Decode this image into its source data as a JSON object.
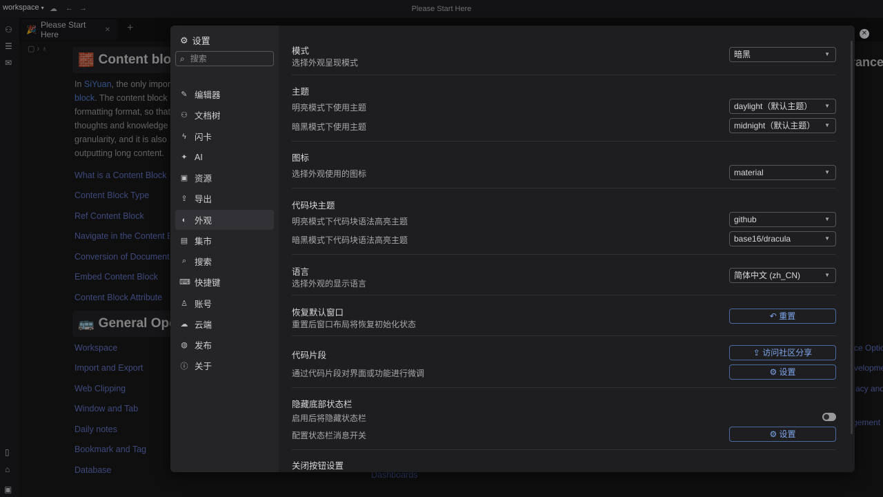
{
  "titlebar": {
    "workspace": "workspace",
    "window_title": "Please Start Here"
  },
  "tab": {
    "label": "Please Start Here"
  },
  "doc": {
    "heading1": "Content bloc",
    "para_prefix": "In ",
    "para_link1": "SiYuan",
    "para_mid": ", the only impor",
    "para_link2": "block",
    "para_rest": ". The content block formatting format, so that thoughts and knowledge granularity, and it is also outputting long content.",
    "links1": [
      "What is a Content Block",
      "Content Block Type",
      "Ref Content Block",
      "Navigate in the Content B",
      "Conversion of Document",
      "Embed Content Block",
      "Content Block Attribute"
    ],
    "heading2": "General Ope",
    "links2": [
      "Workspace",
      "Import and Export",
      "Web Clipping",
      "Window and Tab",
      "Daily notes",
      "Bookmark and Tag",
      "Database"
    ],
    "right_fragments": [
      "rance",
      "ce Optic",
      "velopme",
      "acy and",
      "gement"
    ],
    "bottom_fragment": "Dashboards"
  },
  "settings": {
    "title": "设置",
    "search_placeholder": "搜索",
    "nav": [
      {
        "label": "编辑器",
        "icon": "edit-icon"
      },
      {
        "label": "文档树",
        "icon": "tree-icon"
      },
      {
        "label": "闪卡",
        "icon": "flash-icon"
      },
      {
        "label": "AI",
        "icon": "sparkle-icon"
      },
      {
        "label": "资源",
        "icon": "image-icon"
      },
      {
        "label": "导出",
        "icon": "upload-icon"
      },
      {
        "label": "外观",
        "icon": "palette-icon"
      },
      {
        "label": "集市",
        "icon": "store-icon"
      },
      {
        "label": "搜索",
        "icon": "search-icon"
      },
      {
        "label": "快捷键",
        "icon": "keyboard-icon"
      },
      {
        "label": "账号",
        "icon": "account-icon"
      },
      {
        "label": "云端",
        "icon": "cloud-icon"
      },
      {
        "label": "发布",
        "icon": "globe-icon"
      },
      {
        "label": "关于",
        "icon": "info-icon"
      }
    ],
    "active": "外观",
    "mode": {
      "title": "模式",
      "desc": "选择外观呈现模式",
      "value": "暗黑"
    },
    "theme": {
      "title": "主题",
      "light_label": "明亮模式下使用主题",
      "light_value": "daylight（默认主题）",
      "dark_label": "暗黑模式下使用主题",
      "dark_value": "midnight（默认主题）"
    },
    "icon": {
      "title": "图标",
      "desc": "选择外观使用的图标",
      "value": "material"
    },
    "code_theme": {
      "title": "代码块主题",
      "light_label": "明亮模式下代码块语法高亮主题",
      "light_value": "github",
      "dark_label": "暗黑模式下代码块语法高亮主题",
      "dark_value": "base16/dracula"
    },
    "language": {
      "title": "语言",
      "desc": "选择外观的显示语言",
      "value": "简体中文 (zh_CN)"
    },
    "reset_window": {
      "title": "恢复默认窗口",
      "desc": "重置后窗口布局将恢复初始化状态",
      "button": "重置"
    },
    "snippets": {
      "title": "代码片段",
      "desc": "通过代码片段对界面或功能进行微调",
      "button_share": "访问社区分享",
      "button_settings": "设置"
    },
    "statusbar": {
      "title": "隐藏底部状态栏",
      "toggle_label": "启用后将隐藏状态栏",
      "toggle_on": false,
      "config_label": "配置状态栏消息开关",
      "button": "设置"
    },
    "next_title": "关闭按钮设置"
  }
}
